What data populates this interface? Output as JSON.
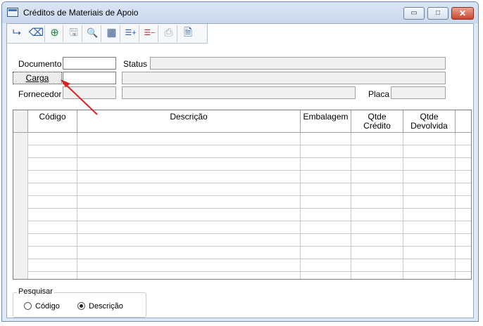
{
  "window": {
    "title": "Créditos de Materiais de Apoio",
    "controls": {
      "minimize": "▭",
      "maximize": "□",
      "close": "✕"
    }
  },
  "toolbar": {
    "buttons": [
      {
        "icon": "exit-icon",
        "glyph": "⮡"
      },
      {
        "icon": "eraser-icon",
        "glyph": "⌫"
      },
      {
        "icon": "add-circle-icon",
        "glyph": "⊕"
      },
      {
        "icon": "save-icon",
        "glyph": "🖫"
      },
      {
        "icon": "search-icon",
        "glyph": "🔍"
      },
      {
        "icon": "table-icon",
        "glyph": "▦"
      },
      {
        "icon": "add-row-icon",
        "glyph": "☰+"
      },
      {
        "icon": "remove-row-icon",
        "glyph": "☰−"
      },
      {
        "icon": "print-icon",
        "glyph": "⎙"
      },
      {
        "icon": "document-icon",
        "glyph": "🗎"
      }
    ]
  },
  "form": {
    "documento_label": "Documento",
    "documento_value": "",
    "status_label": "Status",
    "status_value": "",
    "carga_button": "Carga",
    "carga_value": "",
    "carga_desc": "",
    "fornecedor_label": "Fornecedor",
    "fornecedor_code": "",
    "fornecedor_name": "",
    "placa_label": "Placa",
    "placa_value": ""
  },
  "grid": {
    "columns": [
      {
        "key": "codigo",
        "label": "Código"
      },
      {
        "key": "descricao",
        "label": "Descrição"
      },
      {
        "key": "embalagem",
        "label": "Embalagem"
      },
      {
        "key": "qtde_credito",
        "label": "Qtde\nCrédito"
      },
      {
        "key": "qtde_devolvida",
        "label": "Qtde\nDevolvida"
      }
    ],
    "rows": 12
  },
  "search": {
    "title": "Pesquisar",
    "options": [
      "Código",
      "Descrição"
    ],
    "selected": "Descrição"
  },
  "colors": {
    "annotation_arrow": "#e02020",
    "titlebar": "#c9d9ee",
    "close_button": "#c9462c"
  }
}
